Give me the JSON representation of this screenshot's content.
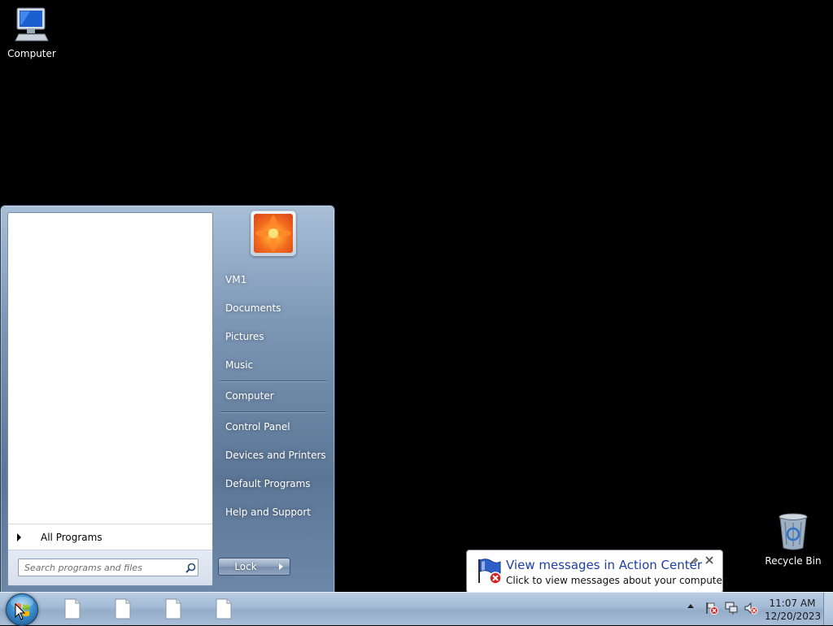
{
  "desktop": {
    "icons": [
      {
        "label": "Computer",
        "icon": "computer-icon"
      },
      {
        "label": "Recycle Bin",
        "icon": "recycle-bin-icon"
      }
    ]
  },
  "start_menu": {
    "all_programs_label": "All Programs",
    "search_placeholder": "Search programs and files",
    "right_items": [
      {
        "label": "VM1"
      },
      {
        "label": "Documents"
      },
      {
        "label": "Pictures"
      },
      {
        "label": "Music"
      },
      {
        "label": "Computer"
      },
      {
        "label": "Control Panel"
      },
      {
        "label": "Devices and Printers"
      },
      {
        "label": "Default Programs"
      },
      {
        "label": "Help and Support"
      }
    ],
    "lock_label": "Lock"
  },
  "notification": {
    "title": "View messages in Action Center",
    "text": "Click to view messages about your computer."
  },
  "taskbar": {
    "pinned": [
      {
        "icon": "document-icon"
      },
      {
        "icon": "document-icon"
      },
      {
        "icon": "document-icon"
      },
      {
        "icon": "document-icon"
      }
    ],
    "clock_time": "11:07 AM",
    "clock_date": "12/20/2023"
  },
  "colors": {
    "desktop_background": "#000000",
    "notification_title": "#1f3fa3"
  }
}
